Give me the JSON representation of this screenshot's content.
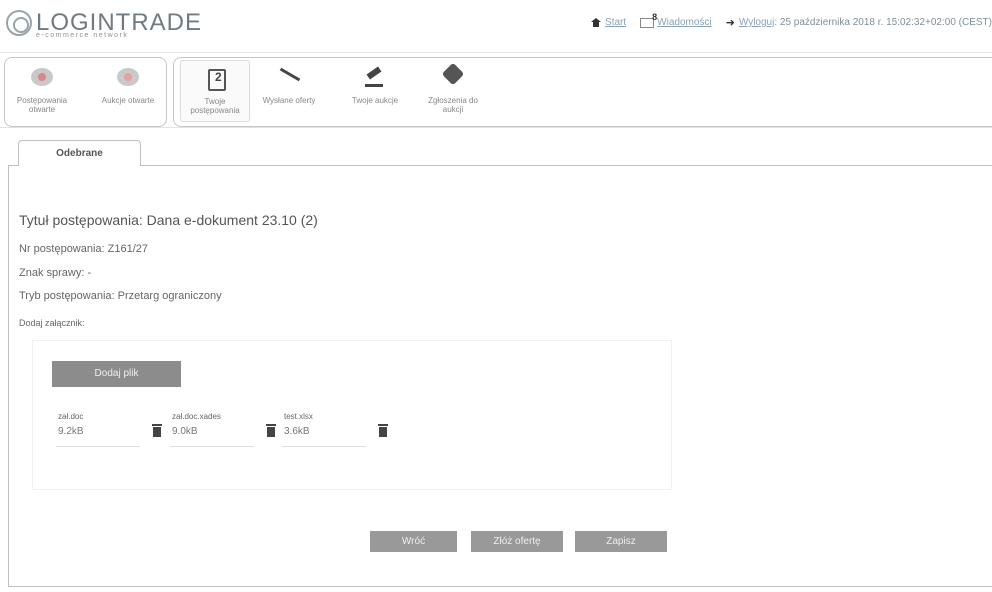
{
  "header": {
    "logo_text": "LOGINTRADE",
    "logo_sub": "e-commerce network",
    "nav": {
      "start": "Start",
      "messages": "Wiadomości",
      "messages_count": "8",
      "logout": "Wyloguj",
      "date": "25 października 2018 r. 15:02:32+02:00 (CEST)"
    }
  },
  "toolbar": {
    "items": [
      {
        "label": "Postępowania otwarte",
        "icon": "chat-bubble-icon"
      },
      {
        "label": "Aukcje otwarte",
        "icon": "chat-bubble-icon"
      },
      {
        "label": "Twoje postępowania",
        "icon": "document-icon"
      },
      {
        "label": "Wysłane oferty",
        "icon": "pen-icon"
      },
      {
        "label": "Twoje aukcje",
        "icon": "gavel-icon"
      },
      {
        "label": "Zgłoszenia do aukcji",
        "icon": "tag-icon"
      }
    ]
  },
  "tab": {
    "label": "Odebrane"
  },
  "main": {
    "title": "Tytuł postępowania: Dana e-dokument 23.10 (2)",
    "number": "Nr postępowania: Z161/27",
    "case": "Znak sprawy: -",
    "mode": "Tryb postępowania: Przetarg ograniczony",
    "attach_label": "Dodaj załącznik:",
    "add_file_button": "Dodaj plik",
    "files": [
      {
        "name": "zał.doc",
        "size": "9.2kB"
      },
      {
        "name": "zał.doc.xades",
        "size": "9.0kB"
      },
      {
        "name": "test.xlsx",
        "size": "3.6kB"
      }
    ],
    "buttons": {
      "back": "Wróć",
      "submit": "Złóż ofertę",
      "save": "Zapisz"
    }
  }
}
